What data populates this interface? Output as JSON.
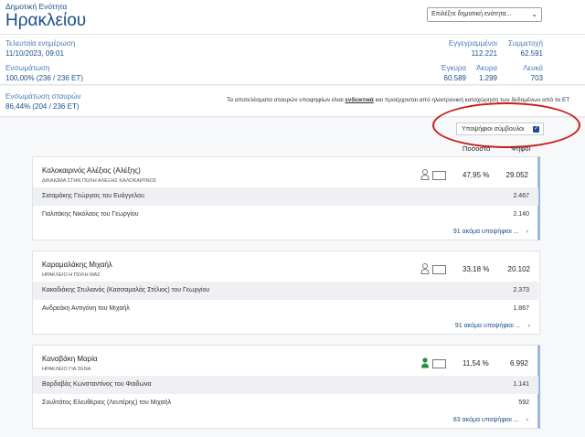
{
  "header": {
    "subtitle": "Δημοτική Ενότητα",
    "title": "Ηρακλείου",
    "select_placeholder": "Επιλέξτε δημοτική ενότητα...",
    "select_chevron": "⌄"
  },
  "stats": {
    "last_update_label": "Τελευταία ενημέρωση",
    "last_update_value": "11/10/2023, 09:01",
    "integration_label": "Ενσωμάτωση",
    "integration_value": "100,00% (236 / 236 ΕΤ)",
    "registered_label": "Εγγεγραμμένοι",
    "registered_value": "112.221",
    "turnout_label": "Συμμετοχή",
    "turnout_value": "62.591",
    "valid_label": "Έγκυρα",
    "valid_value": "60.589",
    "invalid_label": "Άκυρα",
    "invalid_value": "1.299",
    "blank_label": "Λευκά",
    "blank_value": "703"
  },
  "crosses": {
    "label": "Ενσωμάτωση σταυρών",
    "value": "86,44% (204 / 236 ΕΤ)",
    "notice_pre": "Τα αποτελέσματα σταυρών υποψηφίων είναι ",
    "notice_bold": "ενδεικτικά",
    "notice_post": " και προέρχονται από ηλεκτρονική καταχώρηση των δεδομένων από τα ΕΤ"
  },
  "filter": {
    "checkbox_label": "Υποψήφιοι σύμβουλοι",
    "checkbox_mark": "✓"
  },
  "columns": {
    "percent": "Ποσοστό",
    "votes": "Ψήφοι"
  },
  "candidates": [
    {
      "name": "Καλοκαιρινός Αλέξιος (Αλέξης)",
      "party": "ΔΙΚΑΙΩΜΑ ΣΤΗΝ ΠΟΛΗ ΑΛΕΞΗΣ ΚΑΛΟΚΑΙΡΙΝΟΣ",
      "percent": "47,95 %",
      "votes": "29.052",
      "person_color": "#777777",
      "rows": [
        {
          "name": "Σισαμάκης Γεώργιος του Ευάγγελου",
          "votes": "2.467"
        },
        {
          "name": "Γιαλιτάκης Νικόλαος του Γεωργίου",
          "votes": "2.140"
        }
      ],
      "more": "91 ακόμα υποψήφιοι ...",
      "arrow": "›"
    },
    {
      "name": "Καραμαλάκης Μιχαήλ",
      "party": "ΗΡΑΚΛΕΙΟ Η ΠΟΛΗ ΜΑΣ",
      "percent": "33,18 %",
      "votes": "20.102",
      "person_color": "#777777",
      "rows": [
        {
          "name": "Κακαδιάκης Στυλιανός (Κασσαμαλάς Στέλιος) του Γεωργίου",
          "votes": "2.373"
        },
        {
          "name": "Ανδρεάκη Αντιγόνη του Μιχαήλ",
          "votes": "1.867"
        }
      ],
      "more": "91 ακόμα υποψήφιοι ...",
      "arrow": "›"
    },
    {
      "name": "Καναβάκη Μαρία",
      "party": "ΗΡΑΚΛΕΙΟ ΓΙΑ ΣΕΝΑ",
      "percent": "11,54 %",
      "votes": "6.992",
      "person_color": "#2e8b3e",
      "rows": [
        {
          "name": "Βαρδαβάς Κωνσταντίνος του Φαιδωνα",
          "votes": "1.141"
        },
        {
          "name": "Σουλτάτος Ελευθέριος (Λευτέρης) του Μιχαήλ",
          "votes": "592"
        }
      ],
      "more": "83 ακόμα υποψήφιοι ...",
      "arrow": "›"
    }
  ]
}
